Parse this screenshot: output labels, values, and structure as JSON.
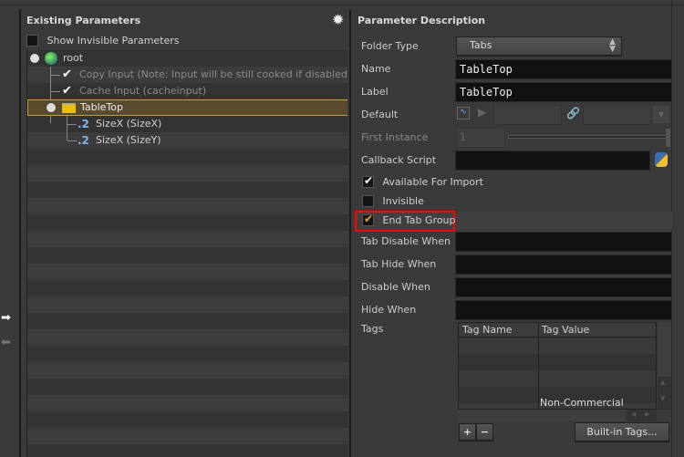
{
  "left": {
    "title": "Existing Parameters",
    "show_invisible_label": "Show Invisible Parameters",
    "tree": [
      {
        "label": "root",
        "icon": "globe-icon"
      },
      {
        "label": "Copy Input (Note: Input will be still cooked if disabled) (copyinput)",
        "icon": "check-icon"
      },
      {
        "label": "Cache Input (cacheinput)",
        "icon": "check-icon"
      },
      {
        "label": "TableTop",
        "icon": "folder-icon",
        "selected": true
      },
      {
        "label": "SizeX (SizeX)",
        "icon": "float-param-icon",
        "glyph": ".2"
      },
      {
        "label": "SizeX (SizeY)",
        "icon": "float-param-icon",
        "glyph": ".2"
      }
    ]
  },
  "right": {
    "title": "Parameter Description",
    "folder_type_label": "Folder Type",
    "folder_type_value": "Tabs",
    "name_label": "Name",
    "name_value": "TableTop",
    "label_label": "Label",
    "label_value": "TableTop",
    "default_label": "Default",
    "first_instance_label": "First Instance",
    "first_instance_value": "1",
    "callback_label": "Callback Script",
    "available_label": "Available For Import",
    "available_checked": true,
    "invisible_label": "Invisible",
    "invisible_checked": false,
    "end_tab_label": "End Tab Group",
    "end_tab_checked": true,
    "tab_disable_label": "Tab Disable When",
    "tab_hide_label": "Tab Hide When",
    "disable_label": "Disable When",
    "hide_label": "Hide When",
    "tags_label": "Tags",
    "tags_columns": [
      "Tag Name",
      "Tag Value"
    ],
    "watermark": "Non-Commercial Edition",
    "add_label": "+",
    "remove_label": "−",
    "builtin_tags_label": "Built-in Tags..."
  },
  "colors": {
    "highlight": "#ff0000",
    "selection": "#c8a030",
    "check_orange": "#f0a020"
  }
}
